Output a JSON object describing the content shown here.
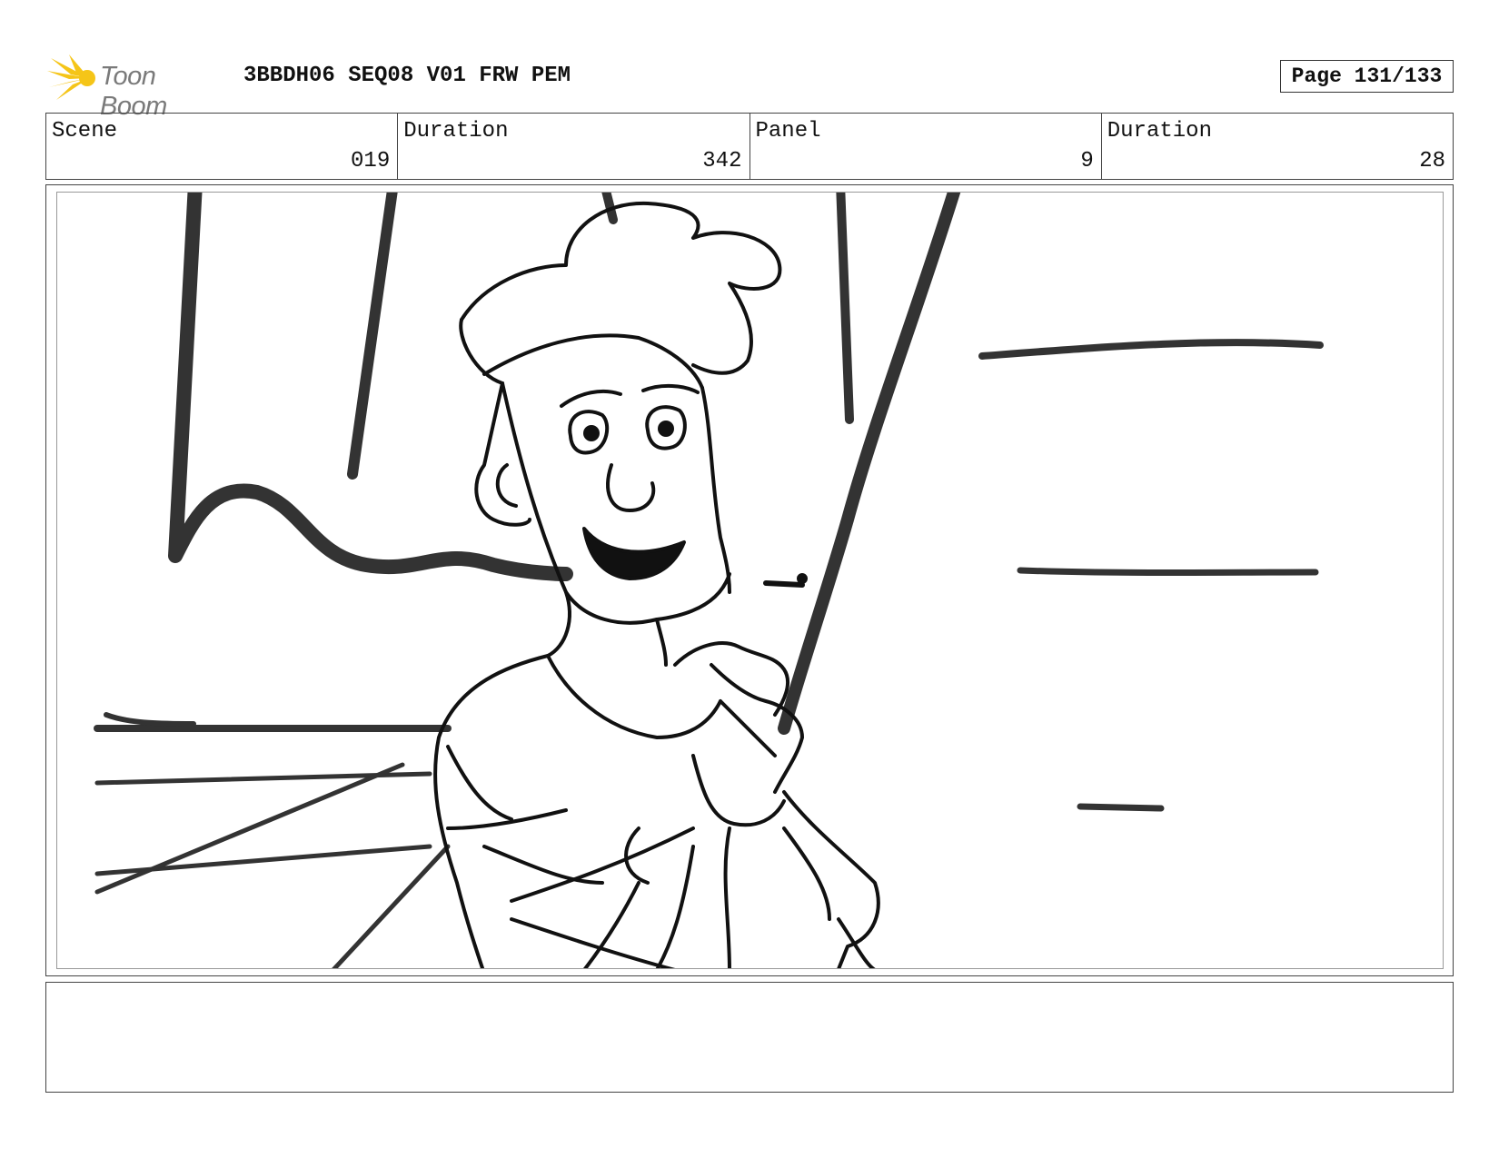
{
  "header": {
    "logo_text": "Toon Boom",
    "document_title": "3BBDH06 SEQ08 V01 FRW PEM",
    "page_label": "Page 131/133"
  },
  "info": {
    "scene_label": "Scene",
    "scene_value": "019",
    "scene_duration_label": "Duration",
    "scene_duration_value": "342",
    "panel_label": "Panel",
    "panel_value": "9",
    "panel_duration_label": "Duration",
    "panel_duration_value": "28"
  },
  "notes": {
    "text": ""
  },
  "colors": {
    "logo_yellow": "#f5c518",
    "logo_text_grey": "#7a7a7a",
    "border": "#444444"
  }
}
